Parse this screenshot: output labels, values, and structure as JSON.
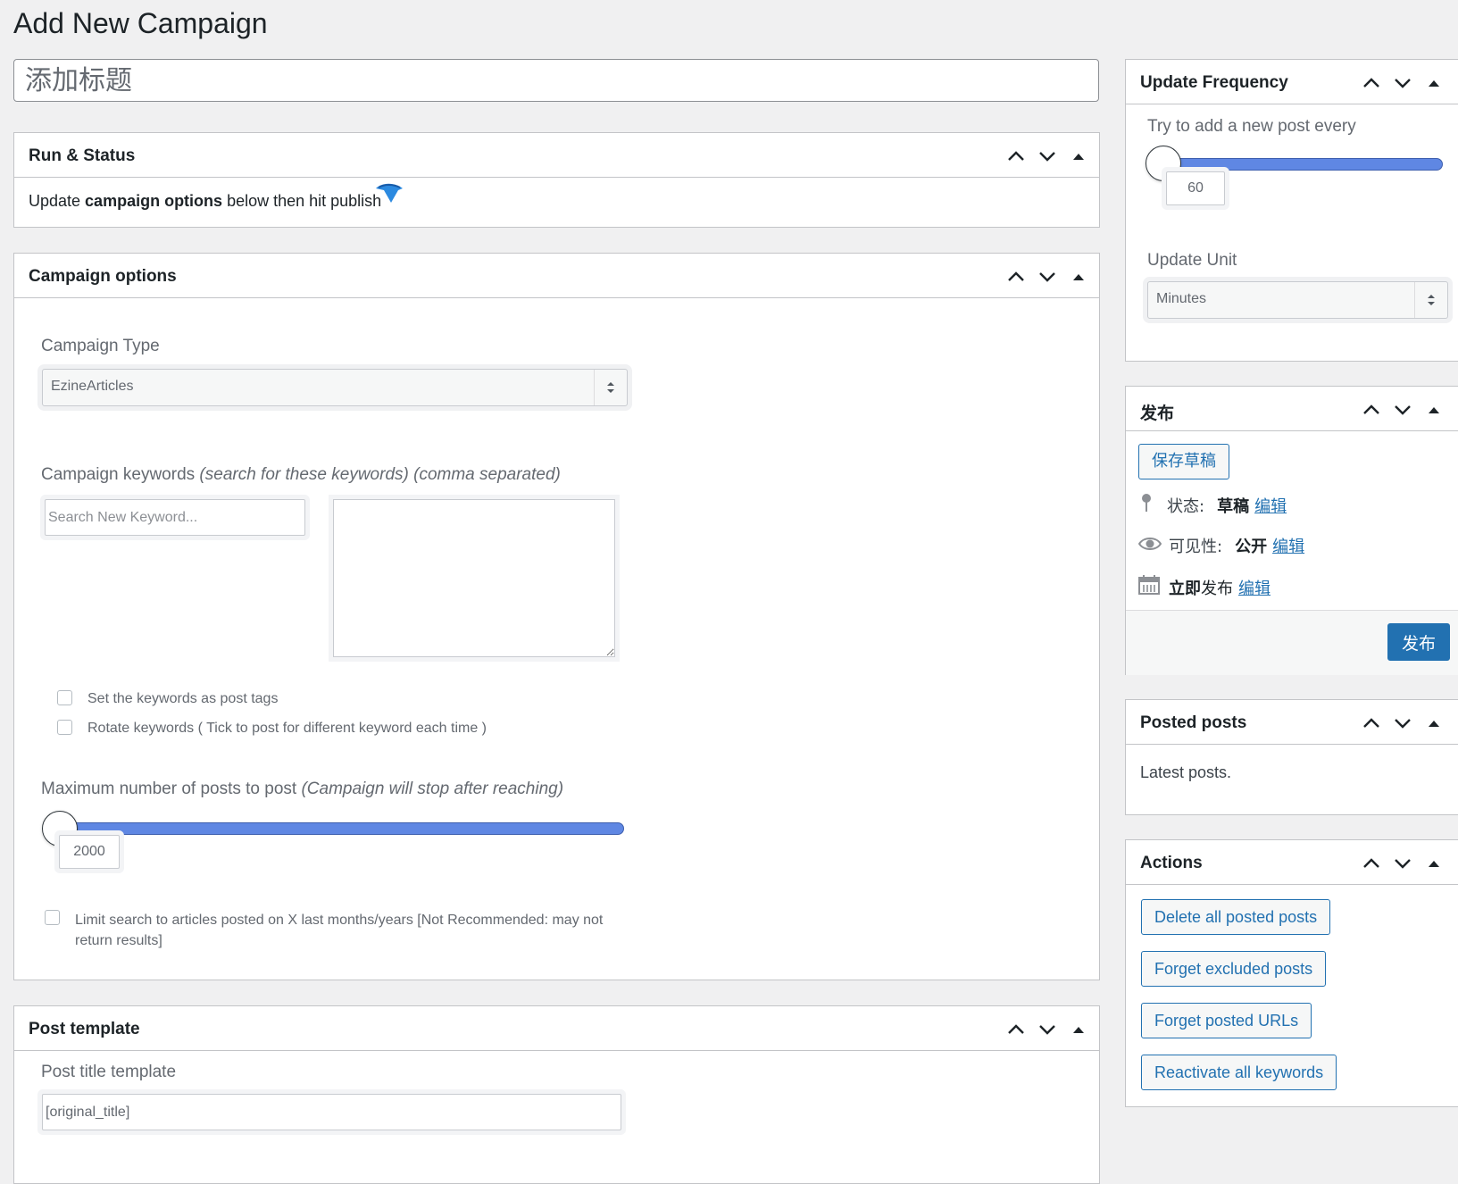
{
  "page": {
    "title": "Add New Campaign"
  },
  "title_field": {
    "placeholder": "添加标题",
    "value": ""
  },
  "run_status": {
    "title": "Run & Status",
    "text_pre": "Update ",
    "text_bold": "campaign options",
    "text_post": " below then hit publish"
  },
  "campaign_options": {
    "title": "Campaign options",
    "type_label": "Campaign Type",
    "type_value": "EzineArticles",
    "keywords_label": "Campaign keywords ",
    "keywords_hint": "(search for these keywords) (comma separated)",
    "keyword_search_placeholder": "Search New Keyword...",
    "check_tags": "Set the keywords as post tags",
    "check_rotate": "Rotate keywords ( Tick to post for different keyword each time )",
    "max_label": "Maximum number of posts to post ",
    "max_hint": "(Campaign will stop after reaching)",
    "max_value": "2000",
    "limit_text": "Limit search to articles posted on X last months/years [Not Recommended: may not return results]"
  },
  "post_template": {
    "title": "Post template",
    "title_template_label": "Post title template",
    "title_template_value": "[original_title]"
  },
  "update_frequency": {
    "title": "Update Frequency",
    "try_label": "Try to add a new post every",
    "value": "60",
    "unit_label": "Update Unit",
    "unit_value": "Minutes"
  },
  "publish": {
    "title": "发布",
    "save_draft": "保存草稿",
    "status_label": "状态:",
    "status_value": "草稿",
    "visibility_label": "可见性:",
    "visibility_value": "公开",
    "publish_time_bold": "立即",
    "publish_time_rest": "发布",
    "edit": "编辑",
    "publish_button": "发布"
  },
  "posted_posts": {
    "title": "Posted posts",
    "text": "Latest posts."
  },
  "actions": {
    "title": "Actions",
    "buttons": [
      "Delete all posted posts",
      "Forget excluded posts",
      "Forget posted URLs",
      "Reactivate all keywords"
    ]
  },
  "colors": {
    "accent": "#2271b1",
    "slider": "#5f87e3"
  }
}
